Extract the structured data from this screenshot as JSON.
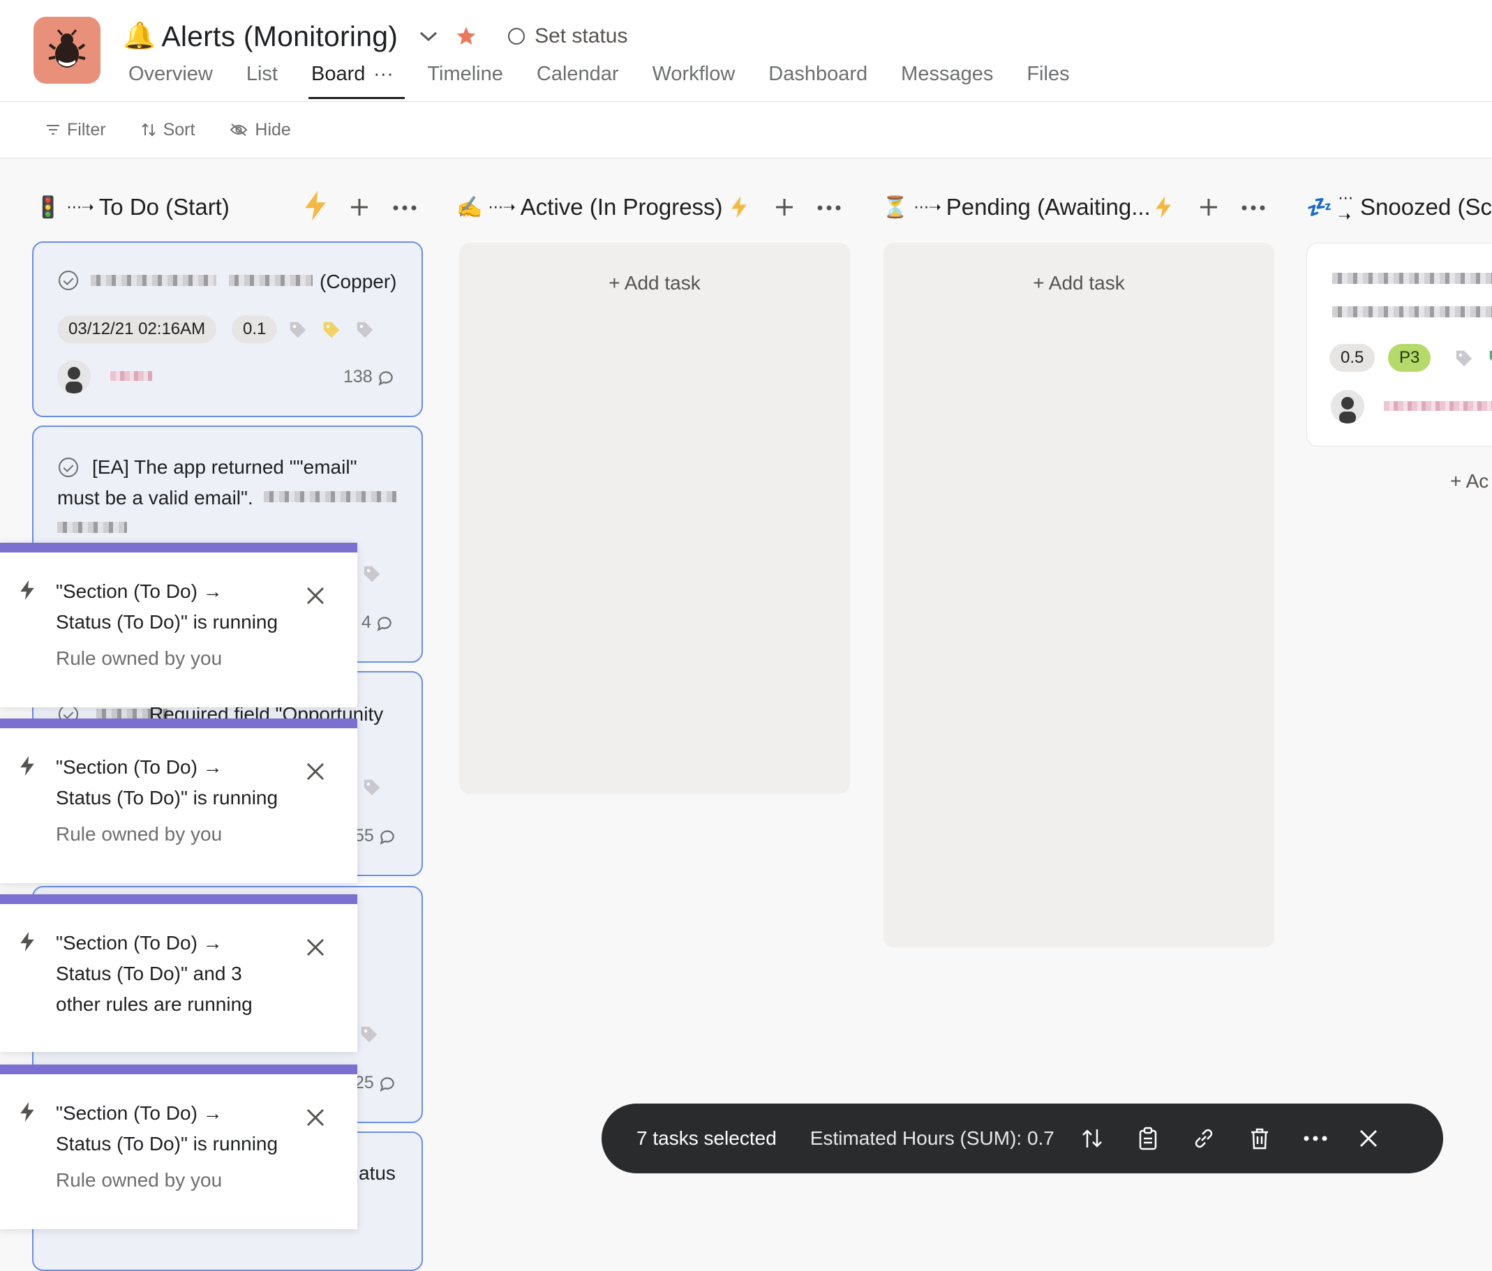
{
  "header": {
    "emoji": "🔔",
    "title": "Alerts (Monitoring)",
    "set_status": "Set status",
    "star_color": "#e8795e",
    "project_icon": "bug-icon",
    "tabs": [
      {
        "label": "Overview"
      },
      {
        "label": "List"
      },
      {
        "label": "Board"
      },
      {
        "label": "Timeline"
      },
      {
        "label": "Calendar"
      },
      {
        "label": "Workflow"
      },
      {
        "label": "Dashboard"
      },
      {
        "label": "Messages"
      },
      {
        "label": "Files"
      }
    ],
    "board_more": "···"
  },
  "toolbar": {
    "filter": "Filter",
    "sort": "Sort",
    "hide": "Hide"
  },
  "columns": [
    {
      "emoji": "🚦",
      "arrow": "⋯➝",
      "title": "To Do (Start)"
    },
    {
      "emoji": "✍️",
      "arrow": "⋯➝",
      "title": "Active (In Progress)",
      "add_task": "+ Add task"
    },
    {
      "emoji": "⏳",
      "arrow": "⋯➝",
      "title": "Pending (Awaiting...",
      "add_task": "+ Add task"
    },
    {
      "emoji": "💤",
      "arrow": "⋯➝",
      "title": "Snoozed (Sc",
      "add_task": "+ Ac"
    }
  ],
  "cards": {
    "c1": {
      "title_suffix": "(Copper)",
      "date": "03/12/21 02:16AM",
      "hours": "0.1",
      "comments": "138"
    },
    "c2": {
      "title": "[EA] The app returned \"\"email\"",
      "title2": "must be a valid email\".",
      "comments": "4"
    },
    "c3": {
      "title": "Required field \"Opportunity",
      "comments": "55"
    },
    "c4": {
      "comments": "25"
    },
    "c5": {
      "title": "atus"
    },
    "s1": {
      "hours": "0.5",
      "priority": "P3"
    }
  },
  "toasts": [
    {
      "line1": "\"Section (To Do) →",
      "line2": "Status (To Do)\" is running",
      "sub": "Rule owned by you"
    },
    {
      "line1": "\"Section (To Do) →",
      "line2": "Status (To Do)\" is running",
      "sub": "Rule owned by you"
    },
    {
      "line1": "\"Section (To Do) →",
      "line2": "Status (To Do)\" and 3",
      "line3": "other rules are running"
    },
    {
      "line1": "\"Section (To Do) →",
      "line2": "Status (To Do)\" is running",
      "sub": "Rule owned by you"
    }
  ],
  "bulk_bar": {
    "count": "7 tasks selected",
    "sum": "Estimated Hours (SUM): 0.7"
  }
}
